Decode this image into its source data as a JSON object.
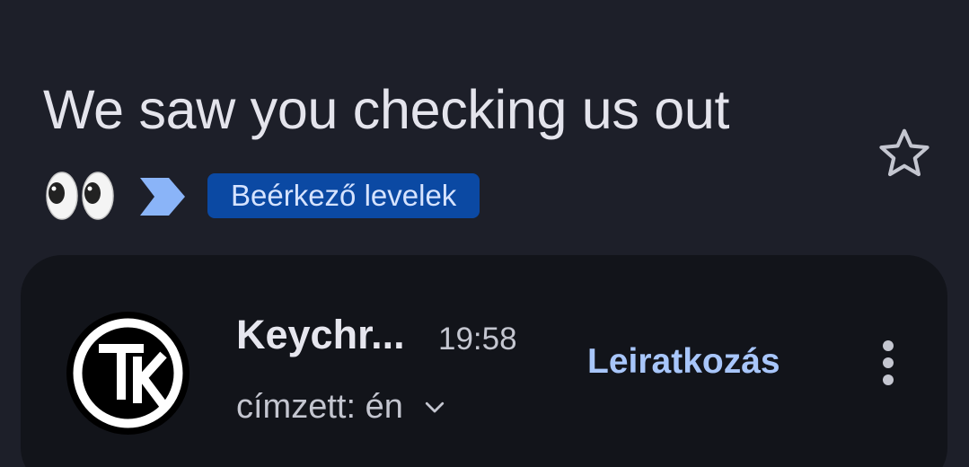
{
  "email": {
    "subject": "We saw you checking us out",
    "subject_emoji": "👀",
    "label": "Beérkező levelek"
  },
  "message": {
    "sender": "Keychr...",
    "time": "19:58",
    "recipient": "címzett: én",
    "unsubscribe_label": "Leiratkozás"
  },
  "icons": {
    "star": "star-outline-icon",
    "importance": "importance-marker-icon",
    "avatar": "tk-logo",
    "chevron": "chevron-down-icon",
    "more": "more-vert-icon"
  },
  "colors": {
    "background": "#1d1f29",
    "card": "#12141a",
    "label_chip": "#0b49a3",
    "link": "#a8c6fa",
    "importance": "#8ab4f8"
  }
}
